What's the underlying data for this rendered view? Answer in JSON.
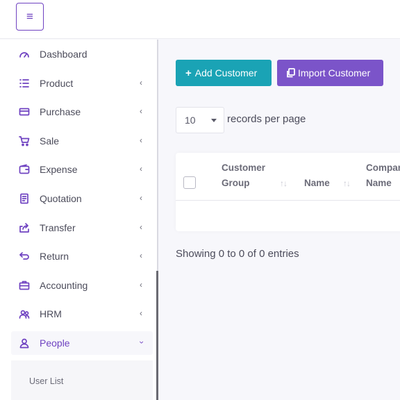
{
  "topbar": {
    "menu_icon": "hamburger-icon"
  },
  "sidebar": {
    "items": [
      {
        "label": "Dashboard",
        "icon": "gauge-icon",
        "has_chevron": false
      },
      {
        "label": "Product",
        "icon": "list-icon",
        "has_chevron": true
      },
      {
        "label": "Purchase",
        "icon": "credit-card-icon",
        "has_chevron": true
      },
      {
        "label": "Sale",
        "icon": "cart-icon",
        "has_chevron": true
      },
      {
        "label": "Expense",
        "icon": "wallet-icon",
        "has_chevron": true
      },
      {
        "label": "Quotation",
        "icon": "document-icon",
        "has_chevron": true
      },
      {
        "label": "Transfer",
        "icon": "share-icon",
        "has_chevron": true
      },
      {
        "label": "Return",
        "icon": "return-icon",
        "has_chevron": true
      },
      {
        "label": "Accounting",
        "icon": "briefcase-icon",
        "has_chevron": true
      },
      {
        "label": "HRM",
        "icon": "users-icon",
        "has_chevron": true
      },
      {
        "label": "People",
        "icon": "user-icon",
        "has_chevron": true,
        "active": true
      }
    ],
    "submenu": {
      "items": [
        {
          "label": "User List"
        }
      ]
    }
  },
  "main": {
    "add_button": "Add Customer",
    "import_button": "Import Customer",
    "per_page_value": "10",
    "per_page_label": "records per page",
    "table": {
      "headers": {
        "group_line1": "Customer",
        "group_line2": "Group",
        "name": "Name",
        "company_line1": "Company",
        "company_line2": "Name"
      },
      "rows": []
    },
    "showing": "Showing 0 to 0 of 0 entries"
  },
  "colors": {
    "accent": "#6f42c1",
    "add_button": "#1aa3b5",
    "import_button": "#7b54c9"
  }
}
